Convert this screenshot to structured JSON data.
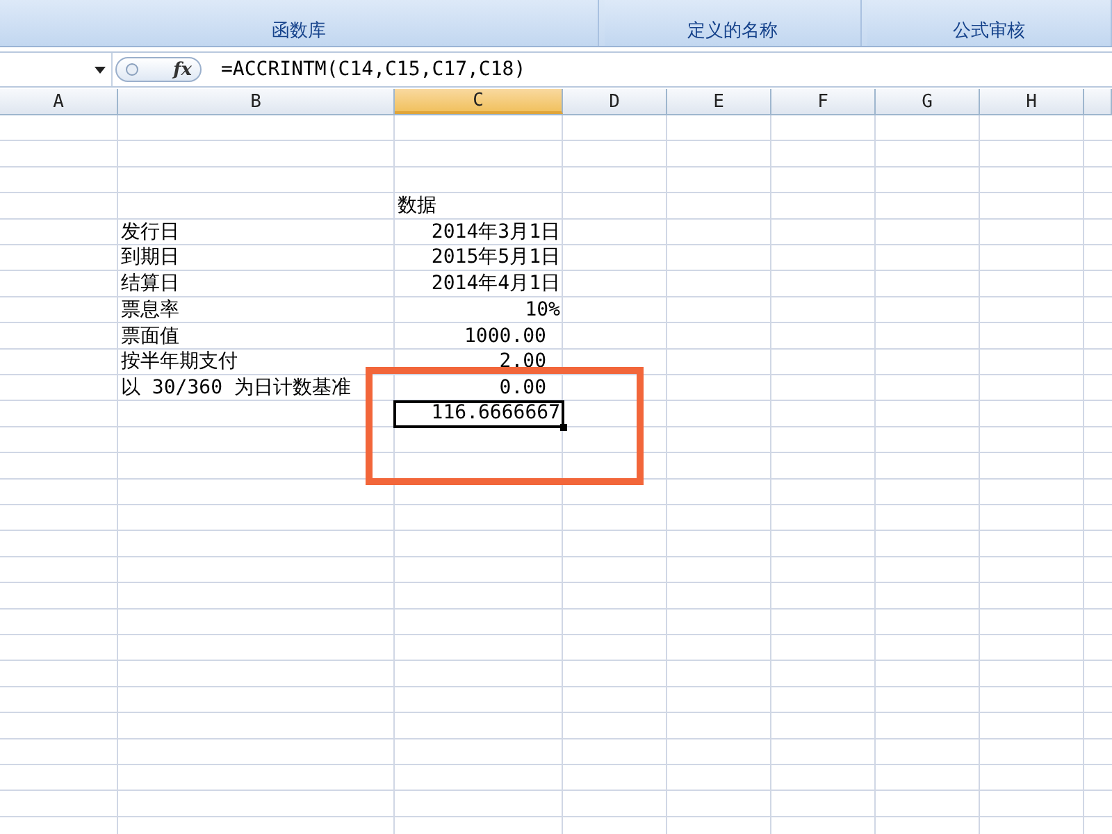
{
  "ribbon": {
    "groups": [
      "函数库",
      "定义的名称",
      "公式审核"
    ]
  },
  "formula_bar": {
    "function_label": "fx",
    "formula": "=ACCRINTM(C14,C15,C17,C18)"
  },
  "columns": [
    {
      "label": "A",
      "selected": false
    },
    {
      "label": "B",
      "selected": false
    },
    {
      "label": "C",
      "selected": true
    },
    {
      "label": "D",
      "selected": false
    },
    {
      "label": "E",
      "selected": false
    },
    {
      "label": "F",
      "selected": false
    },
    {
      "label": "G",
      "selected": false
    },
    {
      "label": "H",
      "selected": false
    }
  ],
  "rows": [
    {
      "label": "",
      "value": "",
      "kind": "blank",
      "selected": false
    },
    {
      "label": "",
      "value": "",
      "kind": "blank",
      "selected": false
    },
    {
      "label": "",
      "value": "",
      "kind": "blank",
      "selected": false
    },
    {
      "label": "",
      "value": "数据",
      "kind": "heading",
      "selected": false
    },
    {
      "label": "发行日",
      "value": "2014年3月1日",
      "kind": "value",
      "selected": false
    },
    {
      "label": "到期日",
      "value": "2015年5月1日",
      "kind": "value",
      "selected": false
    },
    {
      "label": "结算日",
      "value": "2014年4月1日",
      "kind": "value",
      "selected": false
    },
    {
      "label": "票息率",
      "value": "10%",
      "kind": "value",
      "selected": false
    },
    {
      "label": "票面值",
      "value": "1000.00",
      "kind": "number",
      "selected": false
    },
    {
      "label": "按半年期支付",
      "value": "2.00",
      "kind": "number",
      "selected": false
    },
    {
      "label": "以 30/360 为日计数基准",
      "value": "0.00",
      "kind": "number",
      "selected": false
    },
    {
      "label": "",
      "value": "116.6666667",
      "kind": "value",
      "selected": true
    }
  ],
  "highlight": {
    "shown": true
  }
}
